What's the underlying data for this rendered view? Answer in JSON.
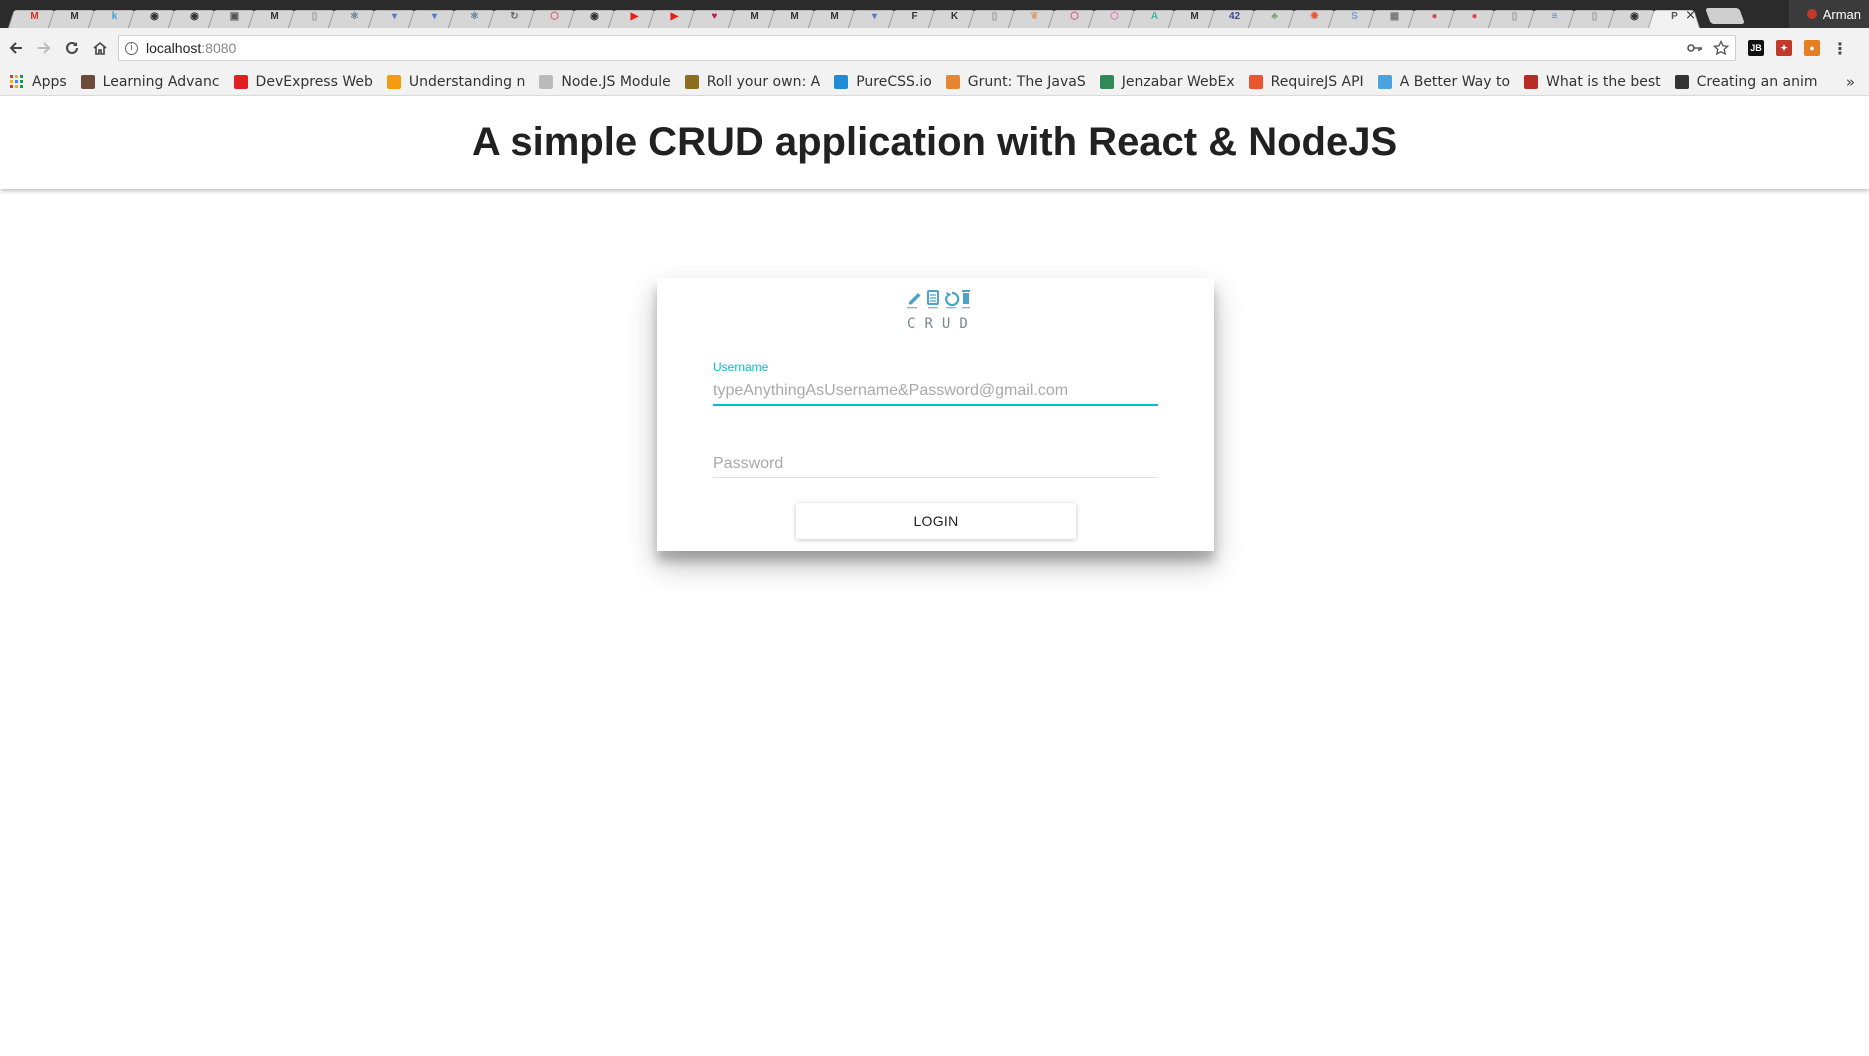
{
  "browser": {
    "tabs": [
      {
        "icon": "gmail-icon",
        "glyph": "M",
        "color": "#d93025"
      },
      {
        "icon": "medium-icon",
        "glyph": "M",
        "color": "#333333"
      },
      {
        "icon": "k-icon",
        "glyph": "k",
        "color": "#3a9fd6"
      },
      {
        "icon": "github-icon",
        "glyph": "◉",
        "color": "#333333"
      },
      {
        "icon": "github-icon",
        "glyph": "◉",
        "color": "#333333"
      },
      {
        "icon": "monitor-icon",
        "glyph": "▣",
        "color": "#555555"
      },
      {
        "icon": "medium-icon",
        "glyph": "M",
        "color": "#333333"
      },
      {
        "icon": "doc-icon",
        "glyph": "▯",
        "color": "#999999"
      },
      {
        "icon": "react-icon",
        "glyph": "⚛",
        "color": "#5b7f95"
      },
      {
        "icon": "shield-icon",
        "glyph": "▾",
        "color": "#4a7fd4"
      },
      {
        "icon": "shield-icon",
        "glyph": "▾",
        "color": "#4a7fd4"
      },
      {
        "icon": "react-icon",
        "glyph": "⚛",
        "color": "#5b7f95"
      },
      {
        "icon": "refresh-icon",
        "glyph": "↻",
        "color": "#666666"
      },
      {
        "icon": "hex-icon",
        "glyph": "⬡",
        "color": "#d5587a"
      },
      {
        "icon": "github-icon",
        "glyph": "◉",
        "color": "#333333"
      },
      {
        "icon": "youtube-icon",
        "glyph": "▶",
        "color": "#e62117"
      },
      {
        "icon": "youtube-icon",
        "glyph": "▶",
        "color": "#e62117"
      },
      {
        "icon": "heart-icon",
        "glyph": "♥",
        "color": "#c2185b"
      },
      {
        "icon": "medium-icon",
        "glyph": "M",
        "color": "#333333"
      },
      {
        "icon": "medium-icon",
        "glyph": "M",
        "color": "#333333"
      },
      {
        "icon": "medium-icon",
        "glyph": "M",
        "color": "#333333"
      },
      {
        "icon": "shield-icon",
        "glyph": "▾",
        "color": "#4a7fd4"
      },
      {
        "icon": "f-icon",
        "glyph": "F",
        "color": "#333333"
      },
      {
        "icon": "kh-icon",
        "glyph": "K",
        "color": "#333333"
      },
      {
        "icon": "doc-icon",
        "glyph": "▯",
        "color": "#999999"
      },
      {
        "icon": "leaf-icon",
        "glyph": "❦",
        "color": "#d8a070"
      },
      {
        "icon": "hex-icon",
        "glyph": "⬡",
        "color": "#d5587a"
      },
      {
        "icon": "hex-icon",
        "glyph": "⬡",
        "color": "#e07ab0"
      },
      {
        "icon": "angular-icon",
        "glyph": "A",
        "color": "#3bb6a6"
      },
      {
        "icon": "medium-icon",
        "glyph": "M",
        "color": "#333333"
      },
      {
        "icon": "number-icon",
        "glyph": "42",
        "color": "#3b4b8f"
      },
      {
        "icon": "leaf-icon",
        "glyph": "♣",
        "color": "#74a86a"
      },
      {
        "icon": "bug-icon",
        "glyph": "✹",
        "color": "#e65a3b"
      },
      {
        "icon": "s-icon",
        "glyph": "S",
        "color": "#6da0d6"
      },
      {
        "icon": "grid-icon",
        "glyph": "▦",
        "color": "#777777"
      },
      {
        "icon": "circle-icon",
        "glyph": "●",
        "color": "#d84b4b"
      },
      {
        "icon": "circle-icon",
        "glyph": "●",
        "color": "#d84b4b"
      },
      {
        "icon": "doc-icon",
        "glyph": "▯",
        "color": "#999999"
      },
      {
        "icon": "docs-icon",
        "glyph": "≡",
        "color": "#4a7fd4"
      },
      {
        "icon": "doc-icon",
        "glyph": "▯",
        "color": "#999999"
      },
      {
        "icon": "github-icon",
        "glyph": "◉",
        "color": "#333333"
      },
      {
        "icon": "page-icon",
        "glyph": "P",
        "color": "#555555",
        "active": true
      }
    ],
    "profile_name": "Arman",
    "url_host": "localhost",
    "url_port": ":8080",
    "bookmarks": [
      {
        "label": "Apps",
        "icon": "apps-grid-icon"
      },
      {
        "label": "Learning Advanc",
        "icon": "avatar-icon",
        "color": "#6b4b3a"
      },
      {
        "label": "DevExpress Web",
        "icon": "devexpress-icon",
        "color": "#e02020"
      },
      {
        "label": "Understanding n",
        "icon": "chevron-icon",
        "color": "#f39c12"
      },
      {
        "label": "Node.JS Module",
        "icon": "page-icon",
        "color": "#bbbbbb"
      },
      {
        "label": "Roll your own: A",
        "icon": "roll-icon",
        "color": "#8a6d1d"
      },
      {
        "label": "PureCSS.io",
        "icon": "purecss-icon",
        "color": "#1f8dd6"
      },
      {
        "label": "Grunt: The JavaS",
        "icon": "grunt-icon",
        "color": "#e48632"
      },
      {
        "label": "Jenzabar WebEx",
        "icon": "jenzabar-icon",
        "color": "#2e8b57"
      },
      {
        "label": "RequireJS API",
        "icon": "requirejs-icon",
        "color": "#e8552f"
      },
      {
        "label": "A Better Way to",
        "icon": "better-icon",
        "color": "#4aa3df"
      },
      {
        "label": "What is the best",
        "icon": "quora-icon",
        "color": "#b92b27"
      },
      {
        "label": "Creating an anim",
        "icon": "calendar-icon",
        "color": "#333333"
      }
    ],
    "bookmarks_more": "»"
  },
  "page": {
    "title": "A simple CRUD application with React & NodeJS",
    "logo_letters": [
      "C",
      "R",
      "U",
      "D"
    ],
    "username": {
      "label": "Username",
      "placeholder": "typeAnythingAsUsername&Password@gmail.com",
      "value": ""
    },
    "password": {
      "placeholder": "Password",
      "value": ""
    },
    "login_label": "LOGIN"
  },
  "colors": {
    "accent": "#00bcd4",
    "logo": "#4aa3c8",
    "title": "#212121"
  }
}
